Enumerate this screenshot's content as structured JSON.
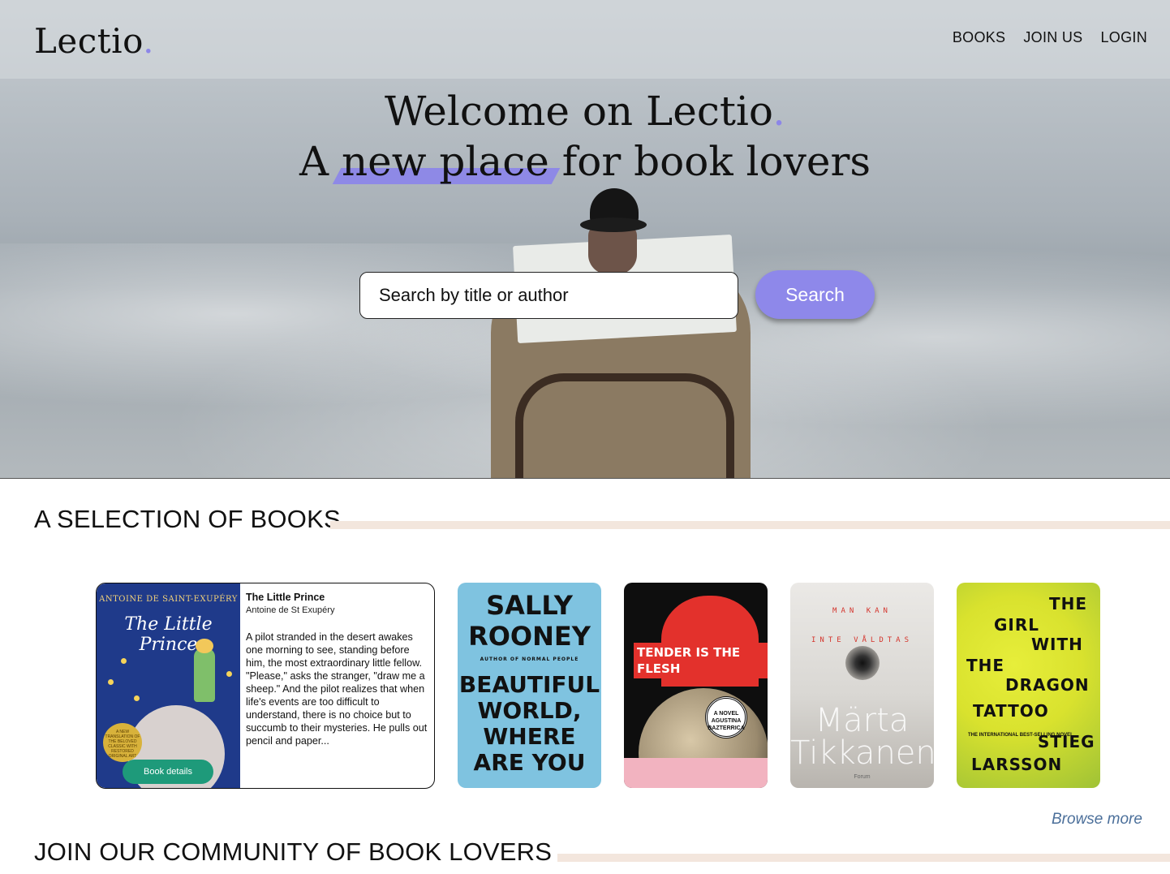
{
  "brand": {
    "logo": "Lectio",
    "logo_dot": "."
  },
  "nav": {
    "items": [
      "BOOKS",
      "JOIN US",
      "LOGIN"
    ]
  },
  "hero": {
    "headline_line1": "Welcome on Lectio",
    "headline_dot": ".",
    "headline_line2_prefix": "A ",
    "headline_line2_highlight": "new place",
    "headline_line2_suffix": " for book lovers",
    "search_placeholder": "Search by title or author",
    "search_button": "Search"
  },
  "selection": {
    "title": "A SELECTION OF BOOKS",
    "featured": {
      "cover_author": "ANTOINE DE SAINT-EXUPÉRY",
      "cover_title": "The Little Prince",
      "cover_seal": "A NEW TRANSLATION OF THE BELOVED CLASSIC WITH RESTORED ORIGINAL ART",
      "title": "The Little Prince",
      "author": "Antoine de St Exupéry",
      "description": "A pilot stranded in the desert awakes one morning to see, standing before him, the most extraordinary little fellow. \"Please,\" asks the stranger, \"draw me a sheep.\" And the pilot realizes that when life's events are too difficult to understand, there is no choice but to succumb to their mysteries. He pulls out pencil and paper...",
      "details_button": "Book details"
    },
    "books": [
      {
        "cover_lines": [
          "SALLY",
          "ROONEY",
          "AUTHOR OF NORMAL PEOPLE",
          "BEAUTIFUL",
          "WORLD,",
          "WHERE",
          "ARE YOU"
        ]
      },
      {
        "cover_title": "TENDER IS THE FLESH",
        "cover_author": "AGUSTINA BAZTERRICA",
        "cover_tag": "A NOVEL"
      },
      {
        "cover_top": "MAN KAN",
        "cover_sub": "INTE VÅLDTAS",
        "cover_author": "Märta Tikkanen",
        "cover_publisher": "Forum"
      },
      {
        "cover_lines": [
          "THE",
          "GIRL",
          "WITH",
          "THE",
          "DRAGON",
          "TATTOO",
          "STIEG",
          "LARSSON"
        ],
        "cover_tagline": "THE INTERNATIONAL BEST-SELLING NOVEL"
      }
    ],
    "browse_more": "Browse more"
  },
  "community": {
    "title": "JOIN OUR COMMUNITY OF BOOK LOVERS"
  },
  "colors": {
    "accent": "#8e88ea",
    "details_button": "#1e9a7a",
    "rule": "#f3e6dd",
    "link": "#4b6f9a"
  }
}
